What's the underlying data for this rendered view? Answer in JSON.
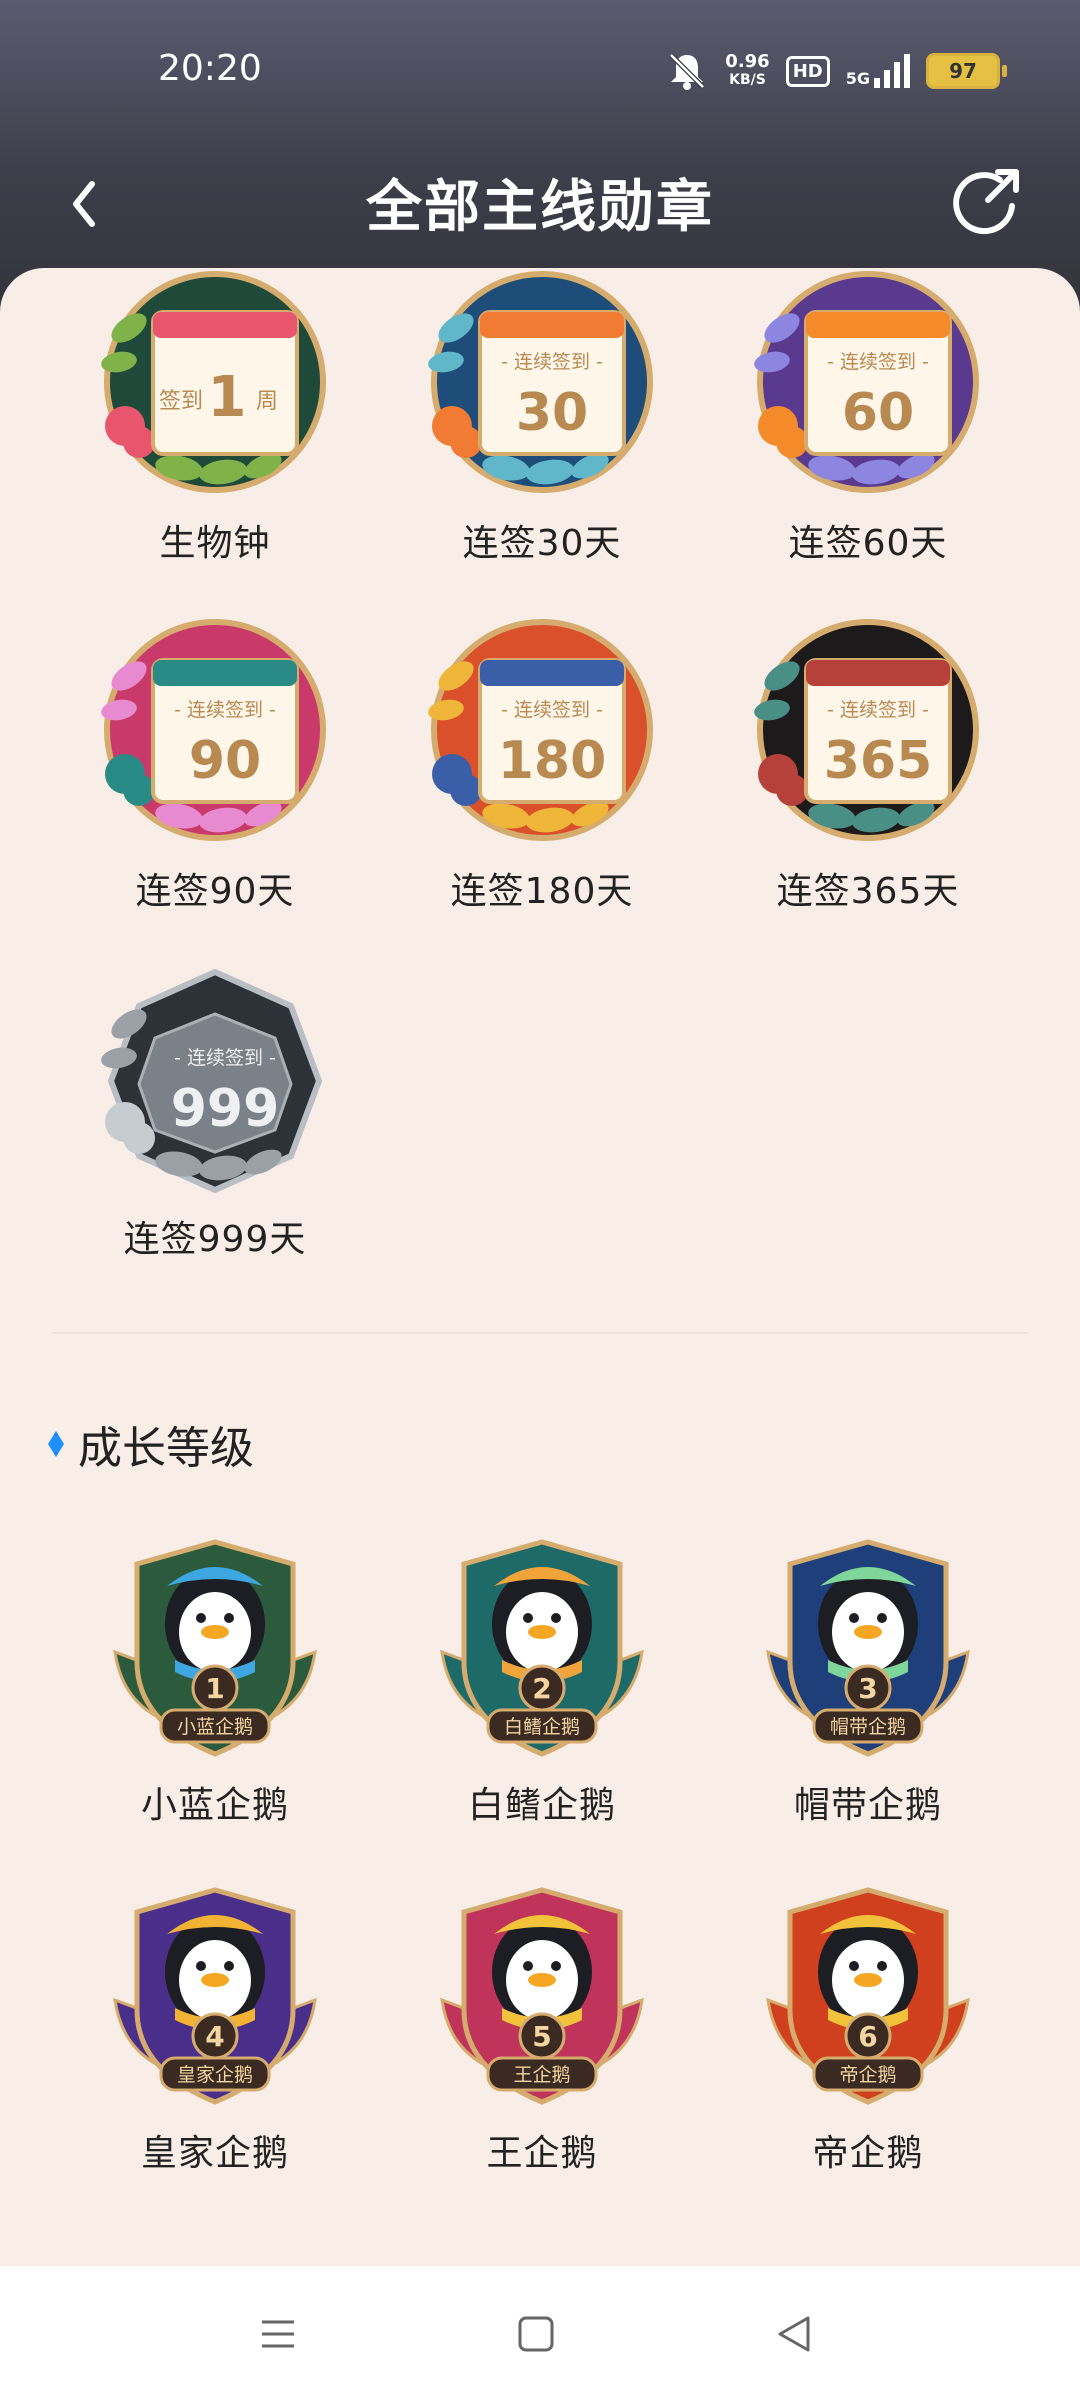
{
  "status_bar": {
    "time": "20:20",
    "net_speed_value": "0.96",
    "net_speed_unit": "KB/S",
    "hd_label": "HD",
    "network_label": "5G",
    "battery_level": "97"
  },
  "header": {
    "title": "全部主线勋章"
  },
  "checkin_medals": [
    {
      "label": "生物钟",
      "badge_top": "签到",
      "badge_number": "1",
      "badge_suffix": "周",
      "frame_color": "#1f4a3a",
      "ribbon_color": "#e8566e"
    },
    {
      "label": "连签30天",
      "badge_top": "连续签到",
      "badge_number": "30",
      "frame_color": "#1e4d7a",
      "ribbon_color": "#f27b34"
    },
    {
      "label": "连签60天",
      "badge_top": "连续签到",
      "badge_number": "60",
      "frame_color": "#5a3a8e",
      "ribbon_color": "#f58a2a"
    },
    {
      "label": "连签90天",
      "badge_top": "连续签到",
      "badge_number": "90",
      "frame_color": "#c93a6a",
      "ribbon_color": "#2a8a86"
    },
    {
      "label": "连签180天",
      "badge_top": "连续签到",
      "badge_number": "180",
      "frame_color": "#d9502a",
      "ribbon_color": "#3a5fa8"
    },
    {
      "label": "连签365天",
      "badge_top": "连续签到",
      "badge_number": "365",
      "frame_color": "#1c1a1a",
      "ribbon_color": "#b5413a"
    },
    {
      "label": "连签999天",
      "badge_top": "连续签到",
      "badge_number": "999",
      "frame_color": "#2d3238",
      "ribbon_color": "#8a8f96"
    }
  ],
  "growth_section": {
    "title": "成长等级",
    "levels": [
      {
        "label": "小蓝企鹅",
        "level": "1",
        "plate": "小蓝企鹅",
        "shield_color": "#2c5a3c",
        "accent_color": "#3ea6e0"
      },
      {
        "label": "白鳍企鹅",
        "level": "2",
        "plate": "白鳍企鹅",
        "shield_color": "#1e6a68",
        "accent_color": "#f0a43a"
      },
      {
        "label": "帽带企鹅",
        "level": "3",
        "plate": "帽带企鹅",
        "shield_color": "#1f3f7a",
        "accent_color": "#7fd69a"
      },
      {
        "label": "皇家企鹅",
        "level": "4",
        "plate": "皇家企鹅",
        "shield_color": "#4a2f8a",
        "accent_color": "#f2b233"
      },
      {
        "label": "王企鹅",
        "level": "5",
        "plate": "王企鹅",
        "shield_color": "#c0335a",
        "accent_color": "#f2c23a"
      },
      {
        "label": "帝企鹅",
        "level": "6",
        "plate": "帝企鹅",
        "shield_color": "#d0401e",
        "accent_color": "#f2c23a"
      }
    ]
  },
  "icons": {
    "back": "chevron-left-icon",
    "refresh": "share-refresh-icon",
    "nav_menu": "menu-icon",
    "nav_home": "home-square-icon",
    "nav_back": "back-triangle-icon"
  },
  "colors": {
    "accent": "#1e90ff",
    "content_bg": "#f9eee7"
  }
}
